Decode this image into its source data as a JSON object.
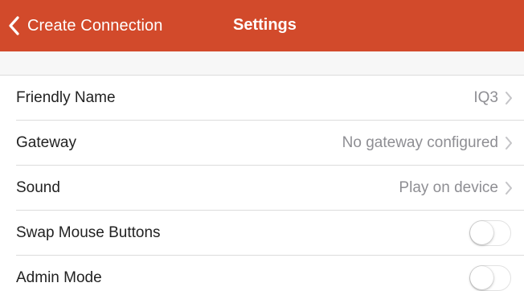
{
  "colors": {
    "nav_bar": "#d24a2b",
    "nav_text": "#ffffff",
    "value_text": "#8e8e93",
    "label_text": "#222222"
  },
  "navbar": {
    "back_label": "Create Connection",
    "back_icon": "chevron-left-icon",
    "title": "Settings"
  },
  "settings": {
    "friendly_name": {
      "label": "Friendly Name",
      "value": "IQ3"
    },
    "gateway": {
      "label": "Gateway",
      "value": "No gateway configured"
    },
    "sound": {
      "label": "Sound",
      "value": "Play on device"
    },
    "swap_mouse_buttons": {
      "label": "Swap Mouse Buttons",
      "enabled": false
    },
    "admin_mode": {
      "label": "Admin Mode",
      "enabled": false
    }
  }
}
